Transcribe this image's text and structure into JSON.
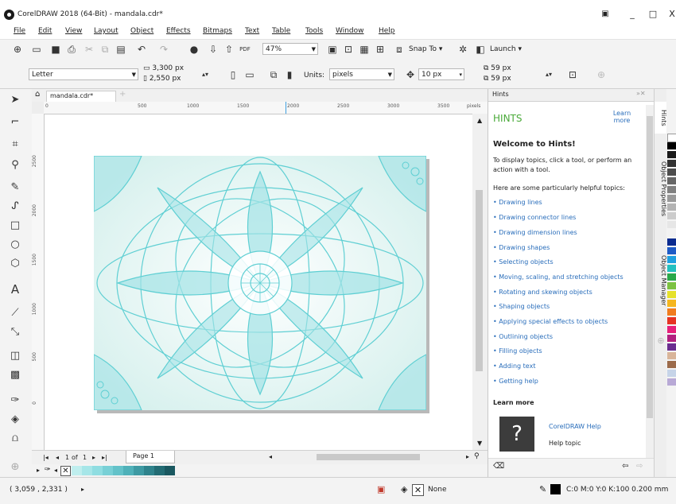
{
  "window": {
    "title": "CorelDRAW 2018 (64-Bit) - mandala.cdr*",
    "minimize_label": "_",
    "maximize_label": "□",
    "close_label": "X"
  },
  "menu": [
    "File",
    "Edit",
    "View",
    "Layout",
    "Object",
    "Effects",
    "Bitmaps",
    "Text",
    "Table",
    "Tools",
    "Window",
    "Help"
  ],
  "toolbar1": {
    "zoom_value": "47%",
    "snap_label": "Snap To",
    "launch_label": "Launch",
    "dupx": "59 px",
    "dupy": "59 px"
  },
  "toolbar2": {
    "page_size": "Letter",
    "width": "3,300 px",
    "height": "2,550 px",
    "units_label": "Units:",
    "units_value": "pixels",
    "nudge": "10 px"
  },
  "doc_tab": {
    "name": "mandala.cdr*",
    "add": "+"
  },
  "ruler": {
    "h_ticks": [
      "0",
      "500",
      "1000",
      "1500",
      "2000",
      "2500",
      "3000",
      "3500"
    ],
    "h_units": "pixels",
    "v_ticks": [
      "2500",
      "2000",
      "1500",
      "1000",
      "500",
      "0"
    ]
  },
  "pager": {
    "current": "1",
    "of_label": "of",
    "total": "1",
    "page_tab": "Page 1"
  },
  "hints": {
    "panel_title": "Hints",
    "heading": "HINTS",
    "learn_more_top": "Learn more",
    "welcome": "Welcome to Hints!",
    "intro": "To display topics, click a tool, or perform an action with a tool.",
    "helpful": "Here are some particularly helpful topics:",
    "links": [
      "• Drawing lines",
      "• Drawing connector lines",
      "• Drawing dimension lines",
      "• Drawing shapes",
      "• Selecting objects",
      "• Moving, scaling, and stretching objects",
      "• Rotating and skewing objects",
      "• Shaping objects",
      "• Applying special effects to objects",
      "• Outlining objects",
      "• Filling objects",
      "• Adding text",
      "• Getting help"
    ],
    "learn_more": "Learn more",
    "help_link": "CorelDRAW Help",
    "help_topic": "Help topic"
  },
  "side_tabs": [
    "Hints",
    "Object Properties",
    "Object Manager"
  ],
  "status": {
    "coords": "( 3,059 , 2,331 )",
    "fill_label": "None",
    "outline_label": "C:0 M:0 Y:0 K:100  0.200 mm"
  },
  "colors": {
    "accent": "#3fbfbf",
    "mandala_line": "#5fcfd3",
    "mandala_fill": "#9fe3e6",
    "hint_heading": "#4aaa3a",
    "link": "#2a6ebb",
    "doc_palette": [
      "#bfeeee",
      "#a6e6e8",
      "#8fdde1",
      "#78d0d6",
      "#63c2c9",
      "#4fb1b9",
      "#3e9aa3",
      "#2f838c",
      "#236c74",
      "#1a5860"
    ],
    "palette": [
      "#ffffff",
      "#000000",
      "#1a1a1a",
      "#333333",
      "#4d4d4d",
      "#666666",
      "#808080",
      "#999999",
      "#b3b3b3",
      "#cccccc",
      "#e6e6e6",
      "#f2f2f2",
      "#0b2b8f",
      "#1f5bc6",
      "#1fa0e0",
      "#23c0c0",
      "#2aa84a",
      "#7cc242",
      "#e6e12b",
      "#f5b61f",
      "#f07c1e",
      "#e63323",
      "#e6207a",
      "#b2207f",
      "#6a2d8f",
      "#d9b59a",
      "#9c6b4b",
      "#c6d4e8",
      "#b8a9d6"
    ]
  }
}
